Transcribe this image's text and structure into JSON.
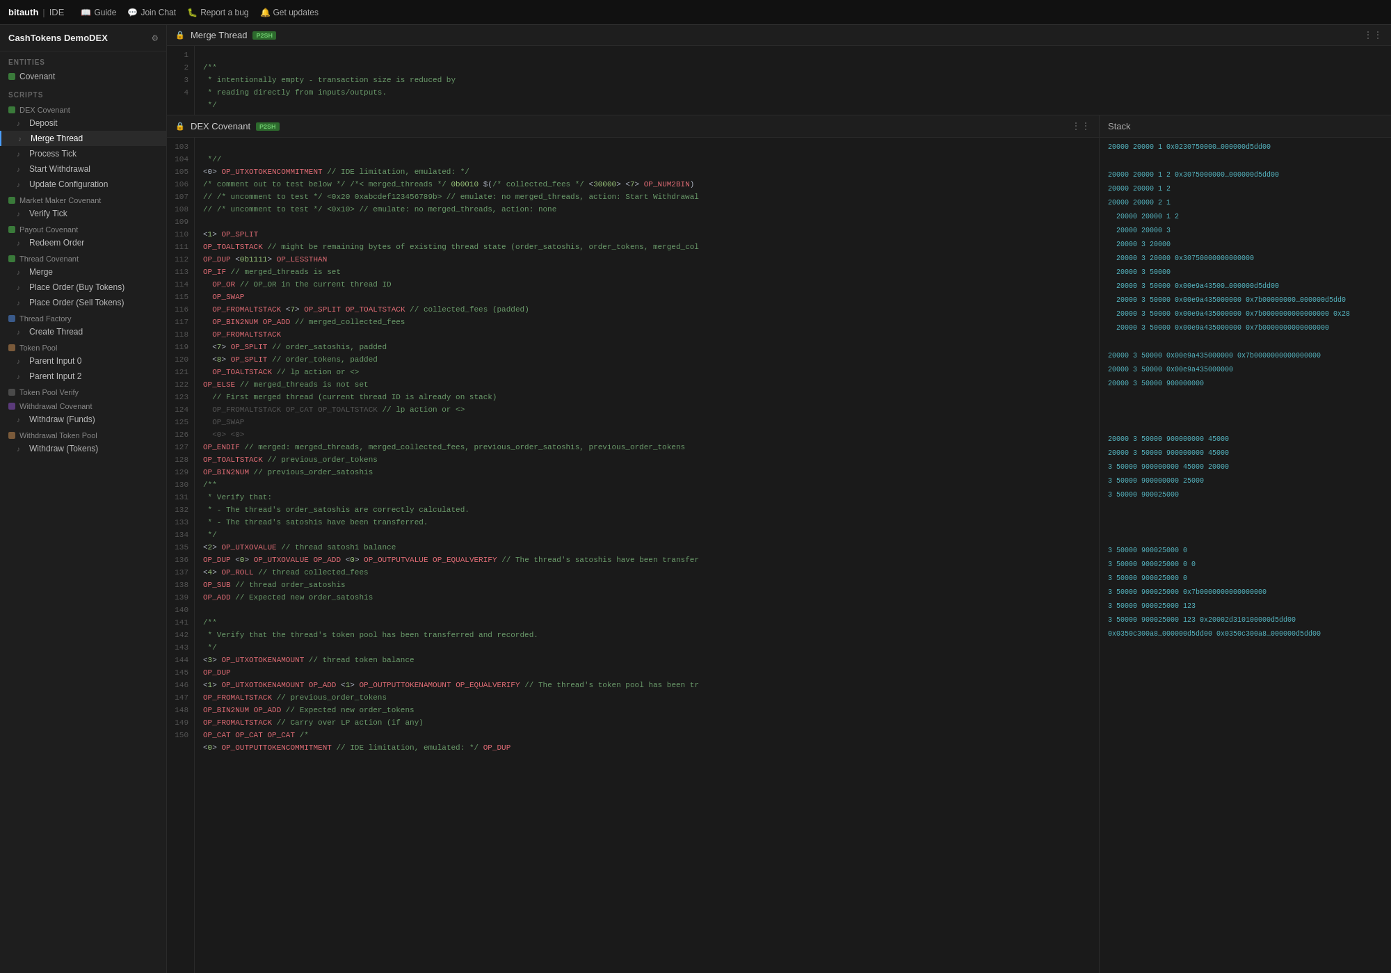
{
  "nav": {
    "brand": "bitauth",
    "divider": "|",
    "ide": "IDE",
    "links": [
      {
        "label": "Guide",
        "icon": "📖"
      },
      {
        "label": "Join Chat",
        "icon": "💬"
      },
      {
        "label": "Report a bug",
        "icon": "🐛"
      },
      {
        "label": "Get updates",
        "icon": "🔔"
      }
    ]
  },
  "sidebar": {
    "app_title": "CashTokens DemoDEX",
    "sections": [
      {
        "label": "ENTITIES",
        "items": [
          {
            "label": "Covenant",
            "type": "entity",
            "icon": ""
          }
        ]
      },
      {
        "label": "SCRIPTS",
        "items": [
          {
            "label": "DEX Covenant",
            "type": "group-covenant",
            "icon": ""
          },
          {
            "label": "Deposit",
            "type": "script",
            "icon": "♪"
          },
          {
            "label": "Merge Thread",
            "type": "script",
            "icon": "♪",
            "active": true
          },
          {
            "label": "Process Tick",
            "type": "script",
            "icon": "♪"
          },
          {
            "label": "Start Withdrawal",
            "type": "script",
            "icon": "♪"
          },
          {
            "label": "Update Configuration",
            "type": "script",
            "icon": "♪"
          },
          {
            "label": "Market Maker Covenant",
            "type": "group-covenant",
            "icon": ""
          },
          {
            "label": "Verify Tick",
            "type": "script",
            "icon": "♪"
          },
          {
            "label": "Payout Covenant",
            "type": "group-covenant",
            "icon": ""
          },
          {
            "label": "Redeem Order",
            "type": "script",
            "icon": "♪"
          },
          {
            "label": "Thread Covenant",
            "type": "group-covenant",
            "icon": ""
          },
          {
            "label": "Merge",
            "type": "script",
            "icon": "♪"
          },
          {
            "label": "Place Order (Buy Tokens)",
            "type": "script",
            "icon": "♪"
          },
          {
            "label": "Place Order (Sell Tokens)",
            "type": "script",
            "icon": "♪"
          },
          {
            "label": "Thread Factory",
            "type": "group-factory",
            "icon": ""
          },
          {
            "label": "Create Thread",
            "type": "script",
            "icon": "♪"
          },
          {
            "label": "Token Pool",
            "type": "group-pool",
            "icon": ""
          },
          {
            "label": "Parent Input 0",
            "type": "script",
            "icon": "♪"
          },
          {
            "label": "Parent Input 2",
            "type": "script",
            "icon": "♪"
          },
          {
            "label": "Token Pool Verify",
            "type": "group-verify",
            "icon": ""
          },
          {
            "label": "Withdrawal Covenant",
            "type": "group-withdrawal",
            "icon": ""
          },
          {
            "label": "Withdraw (Funds)",
            "type": "script",
            "icon": "♪"
          },
          {
            "label": "Withdrawal Token Pool",
            "type": "group-pool",
            "icon": ""
          },
          {
            "label": "Withdraw (Tokens)",
            "type": "script",
            "icon": "♪"
          }
        ]
      }
    ]
  },
  "top_editor": {
    "title": "Merge Thread",
    "badge": "P2SH",
    "lines": [
      {
        "num": "1",
        "code": "/**"
      },
      {
        "num": "2",
        "code": " * intentionally empty - transaction size is reduced by"
      },
      {
        "num": "3",
        "code": " * reading directly from inputs/outputs."
      },
      {
        "num": "4",
        "code": " */"
      }
    ]
  },
  "main_editor": {
    "title": "DEX Covenant",
    "badge": "P2SH",
    "lines": [
      {
        "num": "103",
        "code": " *//",
        "type": "comment"
      },
      {
        "num": "104",
        "code": "<0> OP_UTXOTOKENCOMMITMENT // IDE limitation, emulated: */",
        "type": "mixed"
      },
      {
        "num": "105",
        "code": "/* comment out to test below */ /*< merged_threads */ 0b0010 $(/* collected_fees */ <30000> <7> OP_NUM2BIN)",
        "type": "mixed"
      },
      {
        "num": "106",
        "code": "// /* uncomment to test */ <0x20 0xabcdef123456789b> // emulate: no merged_threads, action: Start Withdrawal",
        "type": "comment"
      },
      {
        "num": "107",
        "code": "// /* uncomment to test */ <0x10> // emulate: no merged_threads, action: none",
        "type": "comment"
      },
      {
        "num": "108",
        "code": "",
        "type": "normal"
      },
      {
        "num": "109",
        "code": "<1> OP_SPLIT",
        "type": "mixed"
      },
      {
        "num": "110",
        "code": "OP_TOALTSTACK // might be remaining bytes of existing thread state (order_satoshis, order_tokens, merged_col",
        "type": "mixed"
      },
      {
        "num": "111",
        "code": "OP_DUP <0b1111> OP_LESSTHAN",
        "type": "mixed"
      },
      {
        "num": "112",
        "code": "OP_IF // merged_threads is set",
        "type": "mixed"
      },
      {
        "num": "113",
        "code": "  OP_OR // OP_OR in the current thread ID",
        "type": "mixed"
      },
      {
        "num": "114",
        "code": "  OP_SWAP",
        "type": "opcode"
      },
      {
        "num": "115",
        "code": "  OP_FROMALTSTACK <7> OP_SPLIT OP_TOALTSTACK // collected_fees (padded)",
        "type": "mixed"
      },
      {
        "num": "116",
        "code": "  OP_BIN2NUM OP_ADD // merged_collected_fees",
        "type": "mixed"
      },
      {
        "num": "117",
        "code": "  OP_FROMALTSTACK",
        "type": "opcode"
      },
      {
        "num": "118",
        "code": "  <7> OP_SPLIT // order_satoshis, padded",
        "type": "mixed"
      },
      {
        "num": "119",
        "code": "  <8> OP_SPLIT // order_tokens, padded",
        "type": "mixed"
      },
      {
        "num": "120",
        "code": "  OP_TOALTSTACK // lp action or <>",
        "type": "mixed"
      },
      {
        "num": "121",
        "code": "OP_ELSE // merged_threads is not set",
        "type": "mixed"
      },
      {
        "num": "122",
        "code": "  // First merged thread (current thread ID is already on stack)",
        "type": "comment"
      },
      {
        "num": "123",
        "code": "  OP_FROMALTSTACK OP_CAT OP_TOALTSTACK // lp action or <>",
        "type": "mixed"
      },
      {
        "num": "124",
        "code": "  OP_SWAP",
        "type": "opcode"
      },
      {
        "num": "125",
        "code": "  <0> <0>",
        "type": "number"
      },
      {
        "num": "126",
        "code": "OP_ENDIF // merged: merged_threads, merged_collected_fees, previous_order_satoshis, previous_order_tokens",
        "type": "mixed"
      },
      {
        "num": "127",
        "code": "OP_TOALTSTACK // previous_order_tokens",
        "type": "mixed"
      },
      {
        "num": "128",
        "code": "OP_BIN2NUM // previous_order_satoshis",
        "type": "opcode"
      },
      {
        "num": "129",
        "code": "/**",
        "type": "comment"
      },
      {
        "num": "130",
        "code": " * Verify that:",
        "type": "comment"
      },
      {
        "num": "131",
        "code": " * - The thread's order_satoshis are correctly calculated.",
        "type": "comment"
      },
      {
        "num": "132",
        "code": " * - The thread's satoshis have been transferred.",
        "type": "comment"
      },
      {
        "num": "133",
        "code": " */",
        "type": "comment"
      },
      {
        "num": "134",
        "code": "<2> OP_UTXOVALUE // thread satoshi balance",
        "type": "mixed"
      },
      {
        "num": "135",
        "code": "OP_DUP <0> OP_UTXOVALUE OP_ADD <0> OP_OUTPUTVALUE OP_EQUALVERIFY // The thread's satoshis have been transfer",
        "type": "mixed"
      },
      {
        "num": "136",
        "code": "<4> OP_ROLL // thread collected_fees",
        "type": "mixed"
      },
      {
        "num": "137",
        "code": "OP_SUB // thread order_satoshis",
        "type": "mixed"
      },
      {
        "num": "138",
        "code": "OP_ADD // Expected new order_satoshis",
        "type": "mixed"
      },
      {
        "num": "139",
        "code": "",
        "type": "normal"
      },
      {
        "num": "140",
        "code": "/**",
        "type": "comment"
      },
      {
        "num": "141",
        "code": " * Verify that the thread's token pool has been transferred and recorded.",
        "type": "comment"
      },
      {
        "num": "142",
        "code": " */",
        "type": "comment"
      },
      {
        "num": "143",
        "code": "<3> OP_UTXOTOKENAMOUNT // thread token balance",
        "type": "mixed"
      },
      {
        "num": "144",
        "code": "OP_DUP",
        "type": "opcode"
      },
      {
        "num": "145",
        "code": "<1> OP_UTXOTOKENAMOUNT OP_ADD <1> OP_OUTPUTTOKENAMOUNT OP_EQUALVERIFY // The thread's token pool has been tr",
        "type": "mixed"
      },
      {
        "num": "146",
        "code": "OP_FROMALTSTACK // previous_order_tokens",
        "type": "mixed"
      },
      {
        "num": "147",
        "code": "OP_BIN2NUM OP_ADD // Expected new order_tokens",
        "type": "mixed"
      },
      {
        "num": "148",
        "code": "OP_FROMALTSTACK // Carry over LP action (if any)",
        "type": "mixed"
      },
      {
        "num": "149",
        "code": "OP_CAT OP_CAT OP_CAT /*",
        "type": "mixed"
      },
      {
        "num": "150",
        "code": "<0> OP_OUTPUTTOKENCOMMITMENT // IDE limitation, emulated: */ OP_DUP",
        "type": "mixed"
      }
    ]
  },
  "stack": {
    "title": "Stack",
    "rows": [
      "20000 20000 1 0x0230750000…000000d5dd00",
      "",
      "20000 20000 1 2 0x3075000000…000000d5dd00",
      "20000 20000 1 2",
      "20000 20000 2 1",
      "  20000 20000 1 2",
      "  20000 20000 3",
      "  20000 3 20000",
      "  20000 3 20000 0x30750000000000000",
      "  20000 3 50000",
      "  20000 3 50000 0x00e9a43500…000000d5dd00",
      "  20000 3 50000 0x00e9a435000000 0x7b00000000…000000d5dd0",
      "  20000 3 50000 0x00e9a435000000 0x7b0000000000000000 0x28",
      "  20000 3 50000 0x00e9a435000000 0x7b0000000000000000",
      "",
      "20000 3 50000 0x00e9a435000000 0x7b0000000000000000",
      "20000 3 50000 0x00e9a435000000",
      "20000 3 50000 900000000",
      "",
      "",
      "",
      "20000 3 50000 900000000 45000",
      "20000 3 50000 900000000 45000",
      "3 50000 900000000 45000 20000",
      "3 50000 900000000 25000",
      "3 50000 900025000",
      "",
      "",
      "",
      "3 50000 900025000 0",
      "3 50000 900025000 0 0",
      "3 50000 900025000 0",
      "3 50000 900025000 0x7b0000000000000000",
      "3 50000 900025000 123",
      "3 50000 900025000 123 0x20002d310100000d5dd00",
      "0x0350c300a8…000000d5dd00 0x0350c300a8…000000d5dd00",
      ""
    ]
  }
}
